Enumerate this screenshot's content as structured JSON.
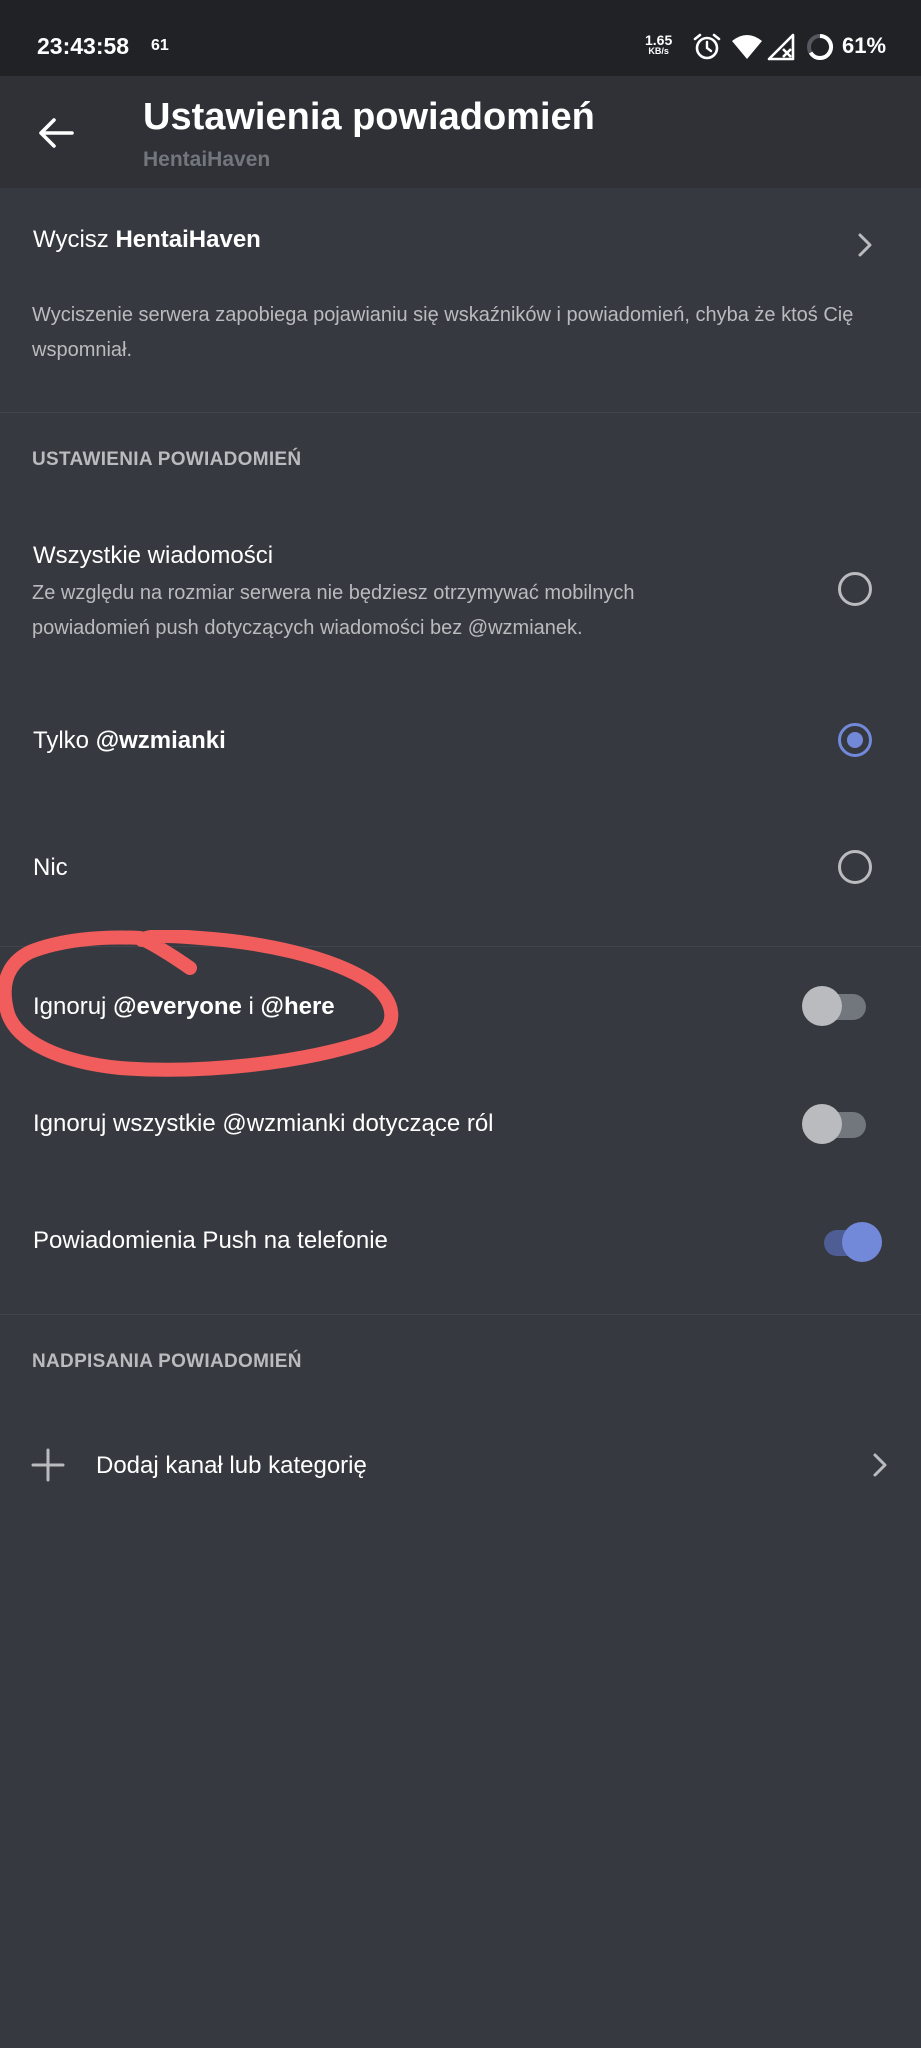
{
  "status_bar": {
    "time": "23:43:58",
    "notification_count": "61",
    "net_speed": "1.65",
    "net_unit": "KB/s",
    "battery": "61%",
    "icons": [
      "alarm-icon",
      "wifi-icon",
      "signal-icon"
    ]
  },
  "header": {
    "title": "Ustawienia powiadomień",
    "subtitle": "HentaiHaven"
  },
  "mute": {
    "label_prefix": "Wycisz ",
    "server_name": "HentaiHaven",
    "description": "Wyciszenie serwera zapobiega pojawianiu się wskaźników i powiadomień, chyba że ktoś Cię wspomniał."
  },
  "notification_settings": {
    "heading": "USTAWIENIA POWIADOMIEŃ",
    "options": [
      {
        "label": "Wszystkie wiadomości",
        "description": "Ze względu na rozmiar serwera nie będziesz otrzymywać mobilnych powiadomień push dotyczących wiadomości bez @wzmianek.",
        "selected": false
      },
      {
        "label_prefix": "Tylko ",
        "label_bold": "@wzmianki",
        "selected": true
      },
      {
        "label": "Nic",
        "selected": false
      }
    ]
  },
  "toggles": [
    {
      "label_prefix": "Ignoruj ",
      "everyone": "@everyone",
      "middle": " i ",
      "here": "@here",
      "on": false
    },
    {
      "label": "Ignoruj wszystkie @wzmianki dotyczące ról",
      "on": false
    },
    {
      "label": "Powiadomienia Push na telefonie",
      "on": true
    }
  ],
  "overrides": {
    "heading": "NADPISANIA POWIADOMIEŃ",
    "add_label": "Dodaj kanał lub kategorię"
  },
  "colors": {
    "background": "#36393f",
    "header_background": "#2f3136",
    "accent": "#7289da",
    "annotation": "#f15c5c"
  }
}
